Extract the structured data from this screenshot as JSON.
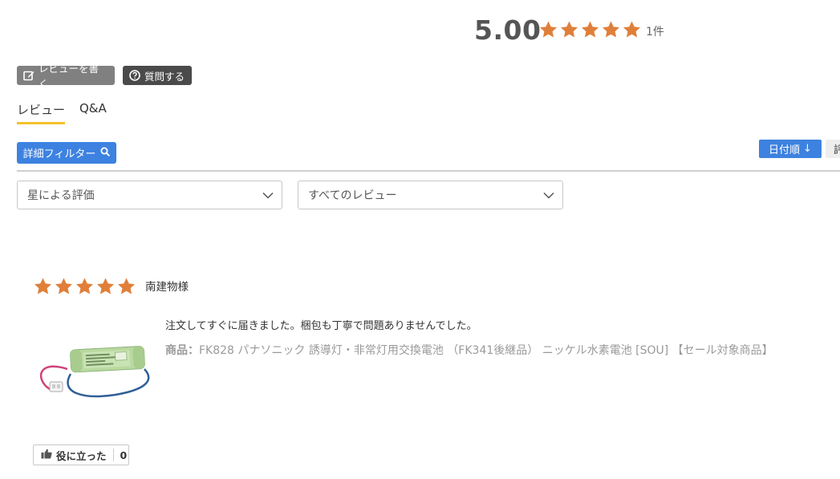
{
  "summary": {
    "score": "5.00",
    "star_count": 5,
    "review_count": "1件",
    "star_color": "#e07f3a"
  },
  "actions": {
    "write_review": "レビューを書く",
    "ask_question": "質問する"
  },
  "tabs": [
    {
      "label": "レビュー",
      "active": true
    },
    {
      "label": "Q&A",
      "active": false
    }
  ],
  "filters": {
    "detail_filter": "詳細フィルター",
    "sort_date": "日付順",
    "sort_date_arrow": "↓",
    "sort_other_partial": "評",
    "star_select_value": "星による評価",
    "review_select_value": "すべてのレビュー"
  },
  "reviews": [
    {
      "stars": 5,
      "reviewer": "南建物様",
      "body": "注文してすぐに届きました。梱包も丁寧で問題ありませんでした。",
      "product_prefix": "商品：",
      "product_name": "FK828 パナソニック 誘導灯・非常灯用交換電池 （FK341後継品） ニッケル水素電池 [SOU] 【セール対象商品】",
      "helpful_label": "役に立った",
      "helpful_count": "0"
    }
  ],
  "colors": {
    "accent_blue": "#3d82e0",
    "tab_underline": "#f3c12b",
    "star": "#e07f3a"
  }
}
